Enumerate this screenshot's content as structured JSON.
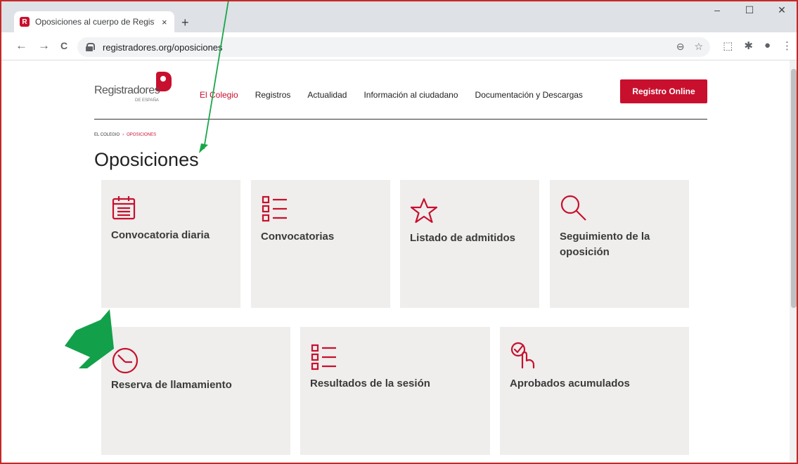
{
  "browser": {
    "tab_title": "Oposiciones al cuerpo de Registr",
    "tab_close": "×",
    "new_tab": "+",
    "url": "registradores.org/oposiciones",
    "window_controls": [
      "–",
      "☐",
      "✕"
    ],
    "nav": {
      "back": "←",
      "forward": "→",
      "reload": "C"
    },
    "omnibox_icons": [
      "⊖",
      "☆"
    ],
    "extension_icons": [
      "⬚",
      "✱",
      "●",
      "⋮"
    ]
  },
  "header": {
    "logo_text": "Registradores",
    "logo_sub": "DE ESPAÑA",
    "nav": [
      "El Colegio",
      "Registros",
      "Actualidad",
      "Información al ciudadano",
      "Documentación y Descargas"
    ],
    "active_nav": "El Colegio",
    "cta": "Registro Online"
  },
  "breadcrumb": {
    "root": "EL COLEGIO",
    "separator": "›",
    "current": "OPOSICIONES"
  },
  "page_title": "Oposiciones",
  "cards": [
    {
      "label": "Convocatoria diaria",
      "icon": "calendar-icon"
    },
    {
      "label": "Convocatorias",
      "icon": "list-icon"
    },
    {
      "label": "Listado de admitidos",
      "icon": "star-icon"
    },
    {
      "label": "Seguimiento de la oposición",
      "icon": "search-icon"
    },
    {
      "label": "Reserva de llamamiento",
      "icon": "clock-icon"
    },
    {
      "label": "Resultados de la sesión",
      "icon": "list-icon"
    },
    {
      "label": "Aprobados acumulados",
      "icon": "tap-check-icon"
    }
  ],
  "colors": {
    "brand": "#c8102e",
    "card_bg": "#efeeec",
    "arrow": "#1aa64a"
  }
}
